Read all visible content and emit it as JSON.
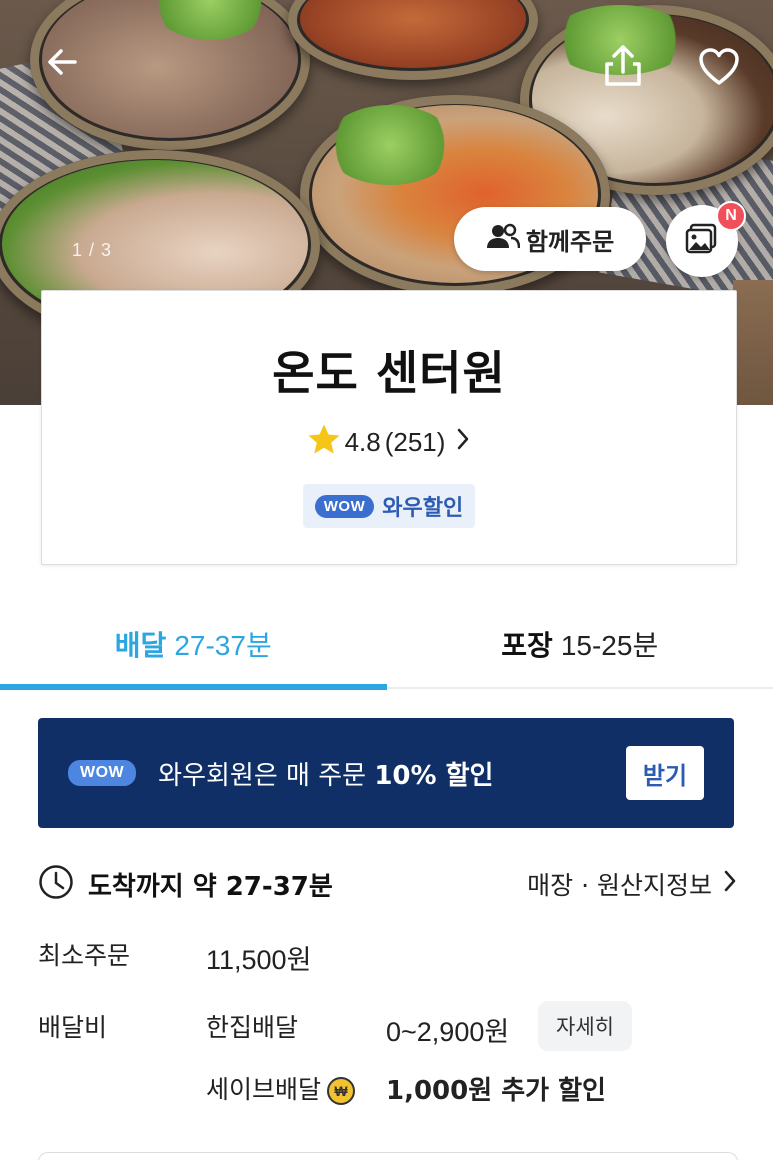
{
  "hero": {
    "image_counter": "1 / 3",
    "together_order_label": "함께주문",
    "photo_badge": "N",
    "icons": [
      "back-arrow-icon",
      "share-icon",
      "heart-icon",
      "people-icon",
      "photo-icon"
    ]
  },
  "store": {
    "name": "온도 센터원",
    "rating": "4.8",
    "review_count": "(251)",
    "wow_pill": "WOW",
    "wow_discount_label": "와우할인"
  },
  "tabs": [
    {
      "label": "배달",
      "time": "27-37분",
      "active": true
    },
    {
      "label": "포장",
      "time": "15-25분",
      "active": false
    }
  ],
  "wow_banner": {
    "pill": "WOW",
    "text_prefix": "와우회원은 매 주문",
    "text_bold": "10% 할인",
    "button_label": "받기"
  },
  "info": {
    "eta_prefix": "도착까지 약",
    "eta_value": "27-37분",
    "store_info_link": "매장 · 원산지정보",
    "min_order_label": "최소주문",
    "min_order_value": "11,500원",
    "delivery_fee_label": "배달비",
    "single_delivery_label": "한집배달",
    "single_delivery_value": "0~2,900원",
    "detail_button": "자세히",
    "save_delivery_label": "세이브배달",
    "save_delivery_value": "1,000원 추가 할인"
  },
  "colors": {
    "accent_blue": "#2aa6e0",
    "wow_navy": "#0f2f66",
    "wow_blue": "#3a6fd0",
    "star": "#f5c518",
    "badge_red": "#f0505a"
  }
}
